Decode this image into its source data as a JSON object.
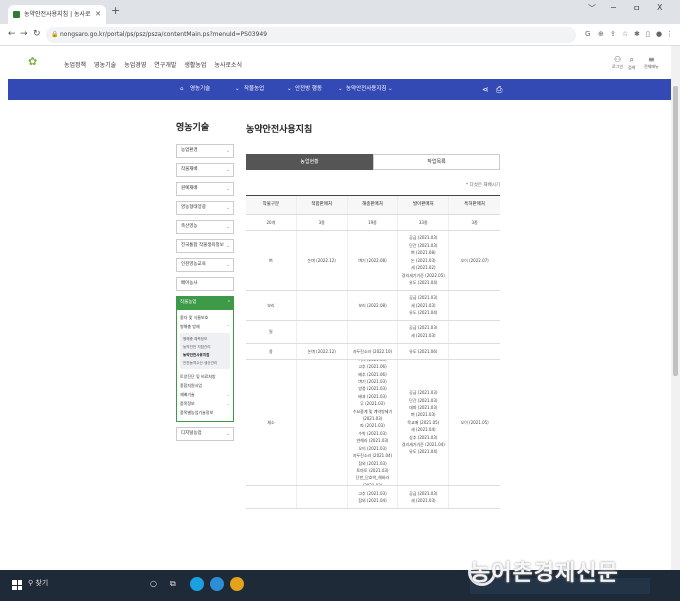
{
  "browser": {
    "tab_title": "농약안전사용지침 | 농사로",
    "new_tab": "+",
    "url": "nongsaro.go.kr/portal/ps/psz/psza/contentMain.ps?menuId=PS03949",
    "win_min": "﹀",
    "win_restore": "−",
    "win_max": "ㅁ",
    "win_close": "X"
  },
  "site": {
    "logo": "농사로",
    "gnb": [
      "농업정책",
      "영농기술",
      "농업경영",
      "연구개발",
      "생활농업",
      "농사로소식"
    ],
    "util": [
      {
        "icon": "person-icon",
        "label": "로그인"
      },
      {
        "icon": "search-icon",
        "label": "검색"
      },
      {
        "icon": "menu-icon",
        "label": "전체메뉴"
      }
    ]
  },
  "breadcrumb": {
    "home": "⌂",
    "items": [
      "영농기술",
      "작물농업",
      "안전방 행동",
      "농약안전사용지침"
    ]
  },
  "sidebar": {
    "heading": "영농기술",
    "items": [
      "농업환경",
      "작물재배",
      "원예재배",
      "영농형태양광",
      "축산영농",
      "전국통합 작물생육정보",
      "인천영농교육",
      "배어농사"
    ],
    "active": "작물농업",
    "sub": [
      {
        "label": "종자 및 식물보호",
        "expand": false
      },
      {
        "label": "병해충 방제",
        "expand": true
      }
    ],
    "sub3": [
      "병해충 예측정보",
      "농약안전 지침관리",
      "농약안전사용지침",
      "안전농약수산 생산관리"
    ],
    "sub_after": [
      {
        "label": "토양진단 및 비료처방",
        "expand": false
      },
      {
        "label": "종합지원사업",
        "expand": false
      },
      {
        "label": "재배기술",
        "expand": true
      },
      {
        "label": "품목정보",
        "expand": true
      },
      {
        "label": "품목별농업기술정보",
        "expand": false
      }
    ],
    "last": "디지털농업"
  },
  "content": {
    "title": "농약안전사용지침",
    "tab_on": "농업현황",
    "tab_off": "작업목록",
    "note": "* 다섯은 재배시기",
    "columns": [
      "작물구분",
      "적합판매처",
      "해충판매처",
      "발아판매처",
      "특허판매처"
    ],
    "rows": [
      {
        "cells": [
          "20개",
          "3종",
          "19종",
          "33종",
          "3종"
        ]
      },
      {
        "cells": [
          "벼",
          "논벼 (2022.12)",
          "벼기 (2022.08)",
          "공급 (2021.03)\n단간 (2021.03)\n벼 (2021.08)\n논 (2021.03)\n세 (2021.02)\n경리세기기준 (2022.05)\n유도 (2021.04)",
          "오이 (2022.07)"
        ]
      },
      {
        "cells": [
          "보리",
          "",
          "보리 (2022.08)",
          "공급 (2021.03)\n세 (2021.03)\n유도 (2021.04)",
          ""
        ]
      },
      {
        "cells": [
          "밀",
          "",
          "",
          "공급 (2021.03)\n세 (2021.03)",
          ""
        ]
      },
      {
        "cells": [
          "콩",
          "논벼 (2022.12)",
          "자두진소라 (2022.10)",
          "유도 (2021.06)",
          ""
        ]
      },
      {
        "cells": [
          "채소",
          "",
          "가지 (2021.03)\n고추 (2021.06)\n배추 (2021.06)\n벼기 (2021.03)\n방풍 (2021.03)\n배과 (2021.03)\n무 (2021.03)\n수요중계 및 계약방제기 (2021.03)\n파 (2021.03)\n수박 (2021.03)\n연해라 (2021.03)\n오이 (2021.03)\n자두진소라 (2021.04)\n참외 (2021.03)\n토마토 (2021.03)\n단판_단호박_해바라 (2021.03)",
          "공급 (2021.03)\n단간 (2021.03)\n대파 (2021.03)\n벼 (2021.03)\n목교매 (2021.05)\n세 (2021.04)\n상추 (2021.03)\n경리세기기준 (2021.04)\n유도 (2021.04)",
          "오이 (2021.05)"
        ]
      },
      {
        "cells": [
          "",
          "",
          "고추 (2021.03)\n참외 (2021.04)",
          "공급 (2021.03)\n세 (2021.03)",
          ""
        ]
      }
    ]
  },
  "taskbar": {
    "search": "찾기",
    "icons": [
      {
        "name": "task-view-icon",
        "color": "#1e2a38"
      },
      {
        "name": "edge-icon",
        "color": "#1aa0e0"
      },
      {
        "name": "store-icon",
        "color": "#2c8fd6"
      },
      {
        "name": "chrome-icon",
        "color": "#e3a21a"
      }
    ]
  },
  "watermark": "농어촌경제신문"
}
